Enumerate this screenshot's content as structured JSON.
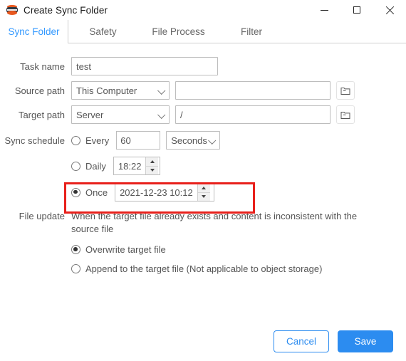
{
  "window": {
    "title": "Create Sync Folder",
    "icon": "stacked-disc-icon",
    "minimize_label": "Minimize",
    "maximize_label": "Maximize",
    "close_label": "Close"
  },
  "tabs": [
    {
      "label": "Sync Folder",
      "active": true
    },
    {
      "label": "Safety",
      "active": false
    },
    {
      "label": "File Process",
      "active": false
    },
    {
      "label": "Filter",
      "active": false
    }
  ],
  "form": {
    "task_name": {
      "label": "Task name",
      "value": "test",
      "placeholder": ""
    },
    "source_path": {
      "label": "Source path",
      "select_value": "This Computer",
      "path_value": "",
      "path_placeholder": "",
      "browse_icon": "folder-icon"
    },
    "target_path": {
      "label": "Target path",
      "select_value": "Server",
      "path_value": "/",
      "path_placeholder": "",
      "browse_icon": "folder-icon"
    },
    "sync_schedule": {
      "label": "Sync schedule",
      "every": {
        "label": "Every",
        "selected": false,
        "interval_value": "60",
        "unit_value": "Seconds"
      },
      "daily": {
        "label": "Daily",
        "selected": false,
        "time_value": "18:22"
      },
      "once": {
        "label": "Once",
        "selected": true,
        "datetime_value": "2021-12-23 10:12"
      }
    },
    "file_update": {
      "label": "File update",
      "description": "When the target file already exists and content is inconsistent with the source file",
      "options": [
        {
          "label": "Overwrite target file",
          "selected": true
        },
        {
          "label": "Append to the target file (Not applicable to object storage)",
          "selected": false
        }
      ]
    }
  },
  "footer": {
    "cancel_label": "Cancel",
    "save_label": "Save"
  },
  "colors": {
    "accent": "#2c8cf0",
    "tab_active": "#3399ff",
    "highlight": "#e8201b",
    "icon_orange": "#e8581f"
  }
}
